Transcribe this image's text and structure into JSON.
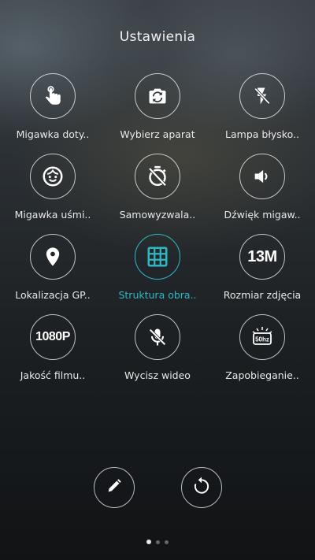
{
  "title": "Ustawienia",
  "settings": [
    {
      "label": "Migawka doty..",
      "icon": "touch-shutter-icon"
    },
    {
      "label": "Wybierz aparat",
      "icon": "switch-camera-icon"
    },
    {
      "label": "Lampa błysko..",
      "icon": "flash-off-icon"
    },
    {
      "label": "Migawka uśmi..",
      "icon": "smile-icon"
    },
    {
      "label": "Samowyzwala..",
      "icon": "timer-off-icon"
    },
    {
      "label": "Dźwięk migaw..",
      "icon": "speaker-icon"
    },
    {
      "label": "Lokalizacja GP..",
      "icon": "location-pin-icon"
    },
    {
      "label": "Struktura obra..",
      "icon": "grid-icon",
      "active": true
    },
    {
      "label": "Rozmiar zdjęcia",
      "icon": "resolution-icon",
      "icon_text": "13M"
    },
    {
      "label": "Jakość filmu..",
      "icon": "video-quality-icon",
      "icon_text": "1080P"
    },
    {
      "label": "Wycisz wideo",
      "icon": "mic-off-icon"
    },
    {
      "label": "Zapobieganie..",
      "icon": "anti-flicker-icon",
      "icon_text": "50hz"
    }
  ],
  "bottom_buttons": [
    {
      "name": "edit-button",
      "icon": "pencil-icon"
    },
    {
      "name": "reset-button",
      "icon": "reset-icon"
    }
  ],
  "page_indicator": {
    "pages": 3,
    "current": 1
  },
  "colors": {
    "accent": "#2fb8c4",
    "text": "#ffffff",
    "ring": "#ffffff"
  }
}
